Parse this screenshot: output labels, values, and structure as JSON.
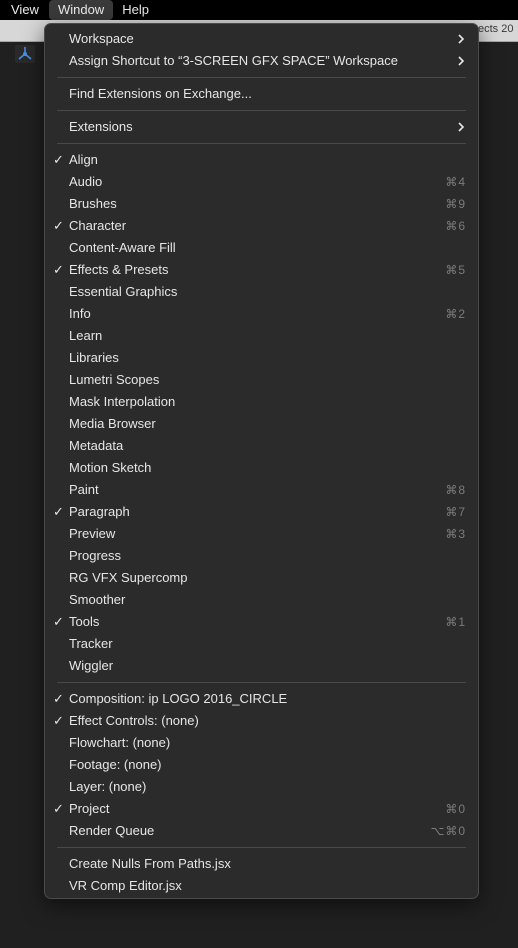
{
  "menubar": {
    "items": [
      "View",
      "Window",
      "Help"
    ]
  },
  "titlebar": {
    "text": "ects 20"
  },
  "menu": {
    "items": [
      {
        "label": "Workspace",
        "submenu": true
      },
      {
        "label": "Assign Shortcut to “3-SCREEN GFX SPACE” Workspace",
        "submenu": true
      },
      {
        "separator": true
      },
      {
        "label": "Find Extensions on Exchange..."
      },
      {
        "separator": true
      },
      {
        "label": "Extensions",
        "submenu": true
      },
      {
        "separator": true
      },
      {
        "label": "Align",
        "checked": true
      },
      {
        "label": "Audio",
        "shortcut": "⌘4"
      },
      {
        "label": "Brushes",
        "shortcut": "⌘9"
      },
      {
        "label": "Character",
        "checked": true,
        "shortcut": "⌘6"
      },
      {
        "label": "Content-Aware Fill"
      },
      {
        "label": "Effects & Presets",
        "checked": true,
        "shortcut": "⌘5"
      },
      {
        "label": "Essential Graphics"
      },
      {
        "label": "Info",
        "shortcut": "⌘2"
      },
      {
        "label": "Learn"
      },
      {
        "label": "Libraries"
      },
      {
        "label": "Lumetri Scopes"
      },
      {
        "label": "Mask Interpolation"
      },
      {
        "label": "Media Browser"
      },
      {
        "label": "Metadata"
      },
      {
        "label": "Motion Sketch"
      },
      {
        "label": "Paint",
        "shortcut": "⌘8"
      },
      {
        "label": "Paragraph",
        "checked": true,
        "shortcut": "⌘7"
      },
      {
        "label": "Preview",
        "shortcut": "⌘3"
      },
      {
        "label": "Progress"
      },
      {
        "label": "RG VFX Supercomp"
      },
      {
        "label": "Smoother"
      },
      {
        "label": "Tools",
        "checked": true,
        "shortcut": "⌘1"
      },
      {
        "label": "Tracker"
      },
      {
        "label": "Wiggler"
      },
      {
        "separator": true
      },
      {
        "label": "Composition: ip LOGO 2016_CIRCLE",
        "checked": true
      },
      {
        "label": "Effect Controls: (none)",
        "checked": true
      },
      {
        "label": "Flowchart: (none)"
      },
      {
        "label": "Footage: (none)"
      },
      {
        "label": "Layer: (none)"
      },
      {
        "label": "Project",
        "checked": true,
        "shortcut": "⌘0"
      },
      {
        "label": "Render Queue",
        "shortcut": "⌥⌘0"
      },
      {
        "separator": true
      },
      {
        "label": "Create Nulls From Paths.jsx"
      },
      {
        "label": "VR Comp Editor.jsx"
      }
    ]
  }
}
